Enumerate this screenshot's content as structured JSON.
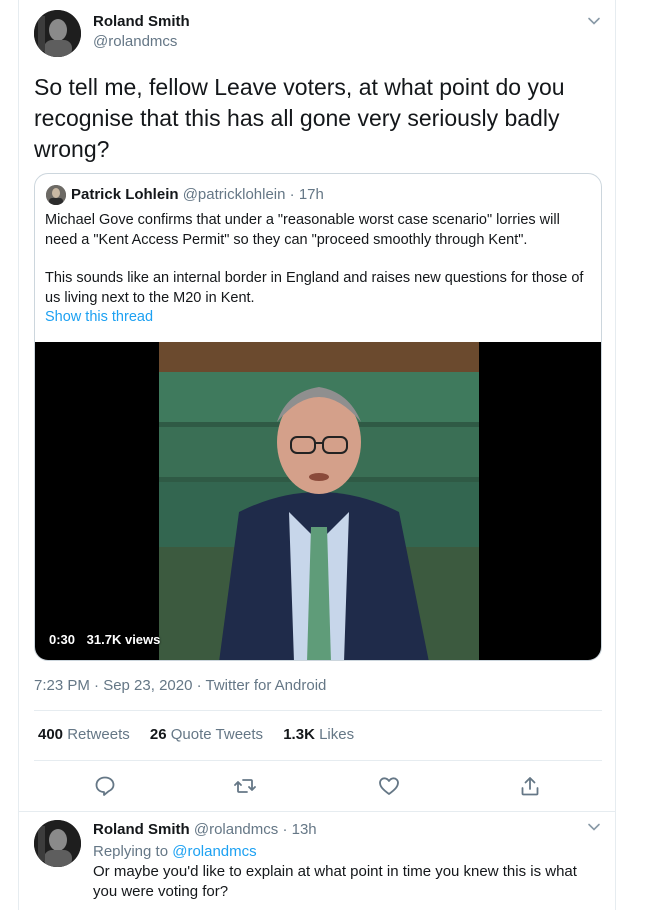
{
  "main_tweet": {
    "author_name": "Roland Smith",
    "author_handle": "@rolandmcs",
    "text": "So tell me, fellow Leave voters, at what point do you recognise that this has all gone very seriously badly wrong?",
    "timestamp": "7:23 PM · Sep 23, 2020 · Twitter for Android",
    "more_icon": "chevron-down-icon"
  },
  "quoted_tweet": {
    "author_name": "Patrick Lohlein",
    "author_handle": "@patricklohlein",
    "time_ago": "· 17h",
    "paragraph_1": "Michael Gove confirms that under a \"reasonable worst case scenario\" lorries will need a \"Kent Access Permit\" so they can \"proceed smoothly through Kent\".",
    "paragraph_2": "This sounds like an internal border in England and raises new questions for those of us living next to the M20 in Kent.",
    "show_thread": "Show this thread",
    "video": {
      "duration": "0:30",
      "views": "31.7K views"
    }
  },
  "stats": {
    "retweets_count": "400",
    "retweets_label": "Retweets",
    "quotes_count": "26",
    "quotes_label": "Quote Tweets",
    "likes_count": "1.3K",
    "likes_label": "Likes"
  },
  "actions": [
    "reply-icon",
    "retweet-icon",
    "like-icon",
    "share-icon"
  ],
  "reply": {
    "author_name": "Roland Smith",
    "author_handle": "@rolandmcs",
    "time_ago": "· 13h",
    "replying_prefix": "Replying to",
    "replying_handle": "@rolandmcs",
    "text": "Or maybe you'd like to explain at what point in time you knew this is what you were voting for?"
  },
  "colors": {
    "link": "#1da1f2",
    "secondary_text": "#657786",
    "border": "#e6ecf0",
    "video_bg": "#000000"
  }
}
